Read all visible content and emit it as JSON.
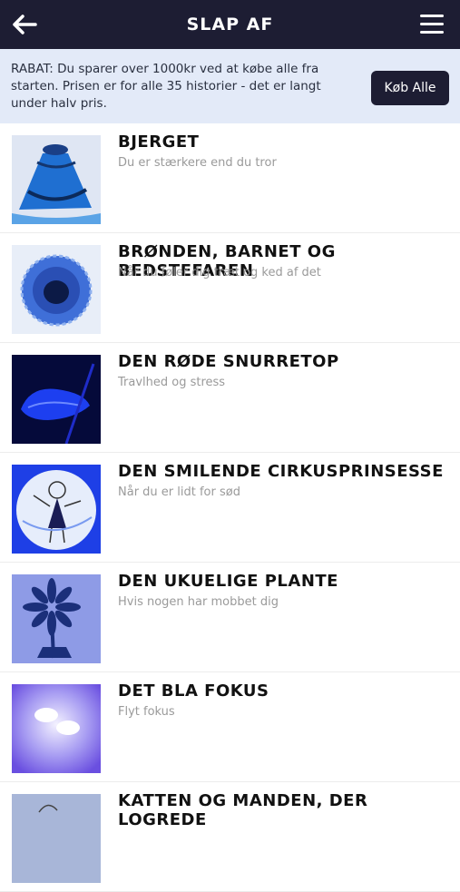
{
  "header": {
    "title": "SLAP AF",
    "back_icon": "arrow-left-icon",
    "menu_icon": "hamburger-menu-icon"
  },
  "banner": {
    "text": "RABAT: Du sparer over 1000kr ved at købe alle fra starten. Prisen er for alle 35 historier - det er langt under halv pris.",
    "button_label": "Køb Alle"
  },
  "stories": [
    {
      "title": "BJERGET",
      "subtitle": "Du er stærkere end du tror"
    },
    {
      "title": "BRØNDEN, BARNET OG BEDSTEFAREN",
      "subtitle": "Når du føler dig træt og ked af det"
    },
    {
      "title": "DEN RØDE SNURRETOP",
      "subtitle": "Travlhed og stress"
    },
    {
      "title": "DEN SMILENDE CIRKUSPRINSESSE",
      "subtitle": "Når du er lidt for sød"
    },
    {
      "title": "DEN UKUELIGE PLANTE",
      "subtitle": "Hvis nogen har mobbet dig"
    },
    {
      "title": "DET BLA FOKUS",
      "subtitle": "Flyt fokus"
    },
    {
      "title": "KATTEN OG MANDEN, DER LOGREDE",
      "subtitle": ""
    }
  ],
  "colors": {
    "header_bg": "#1d1d33",
    "banner_bg": "#e3eaf8",
    "subtitle": "#9a9a9a"
  }
}
